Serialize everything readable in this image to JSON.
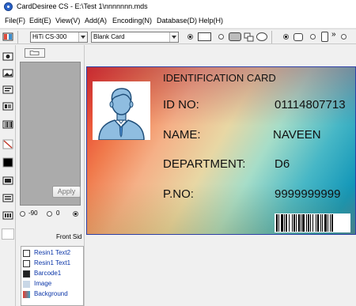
{
  "window": {
    "title": "CardDesiree CS - E:\\Test 1\\nnnnnnn.mds"
  },
  "menu": {
    "items": [
      "File(F)",
      "Edit(E)",
      "View(V)",
      "Add(A)",
      "Encoding(N)",
      "Database(D)",
      "Help(H)"
    ]
  },
  "toolbar": {
    "printer_select": "HiTi CS-300",
    "card_select": "Blank Card",
    "overflow_glyph": "»"
  },
  "panel": {
    "rotation_options": [
      "-90",
      "0",
      ""
    ],
    "rotation_selected": 2,
    "apply_label": "Apply",
    "side_label": "Front Sid",
    "layers": [
      "Resin1 Text2",
      "Resin1 Text1",
      "Barcode1",
      "Image",
      "Background"
    ]
  },
  "card": {
    "title": "IDENTIFICATION CARD",
    "id_label": "ID NO:",
    "id_value": "01114807713",
    "name_label": "NAME:",
    "name_value": "NAVEEN",
    "dept_label": "DEPARTMENT:",
    "dept_value": "D6",
    "pno_label": "P.NO:",
    "pno_value": "9999999999"
  },
  "colors": {
    "card_border": "#2d3fa6",
    "layer_text": "#0a35a8",
    "avatar_bg": "#8fbde0",
    "avatar_shirt": "#3c7fc4"
  }
}
